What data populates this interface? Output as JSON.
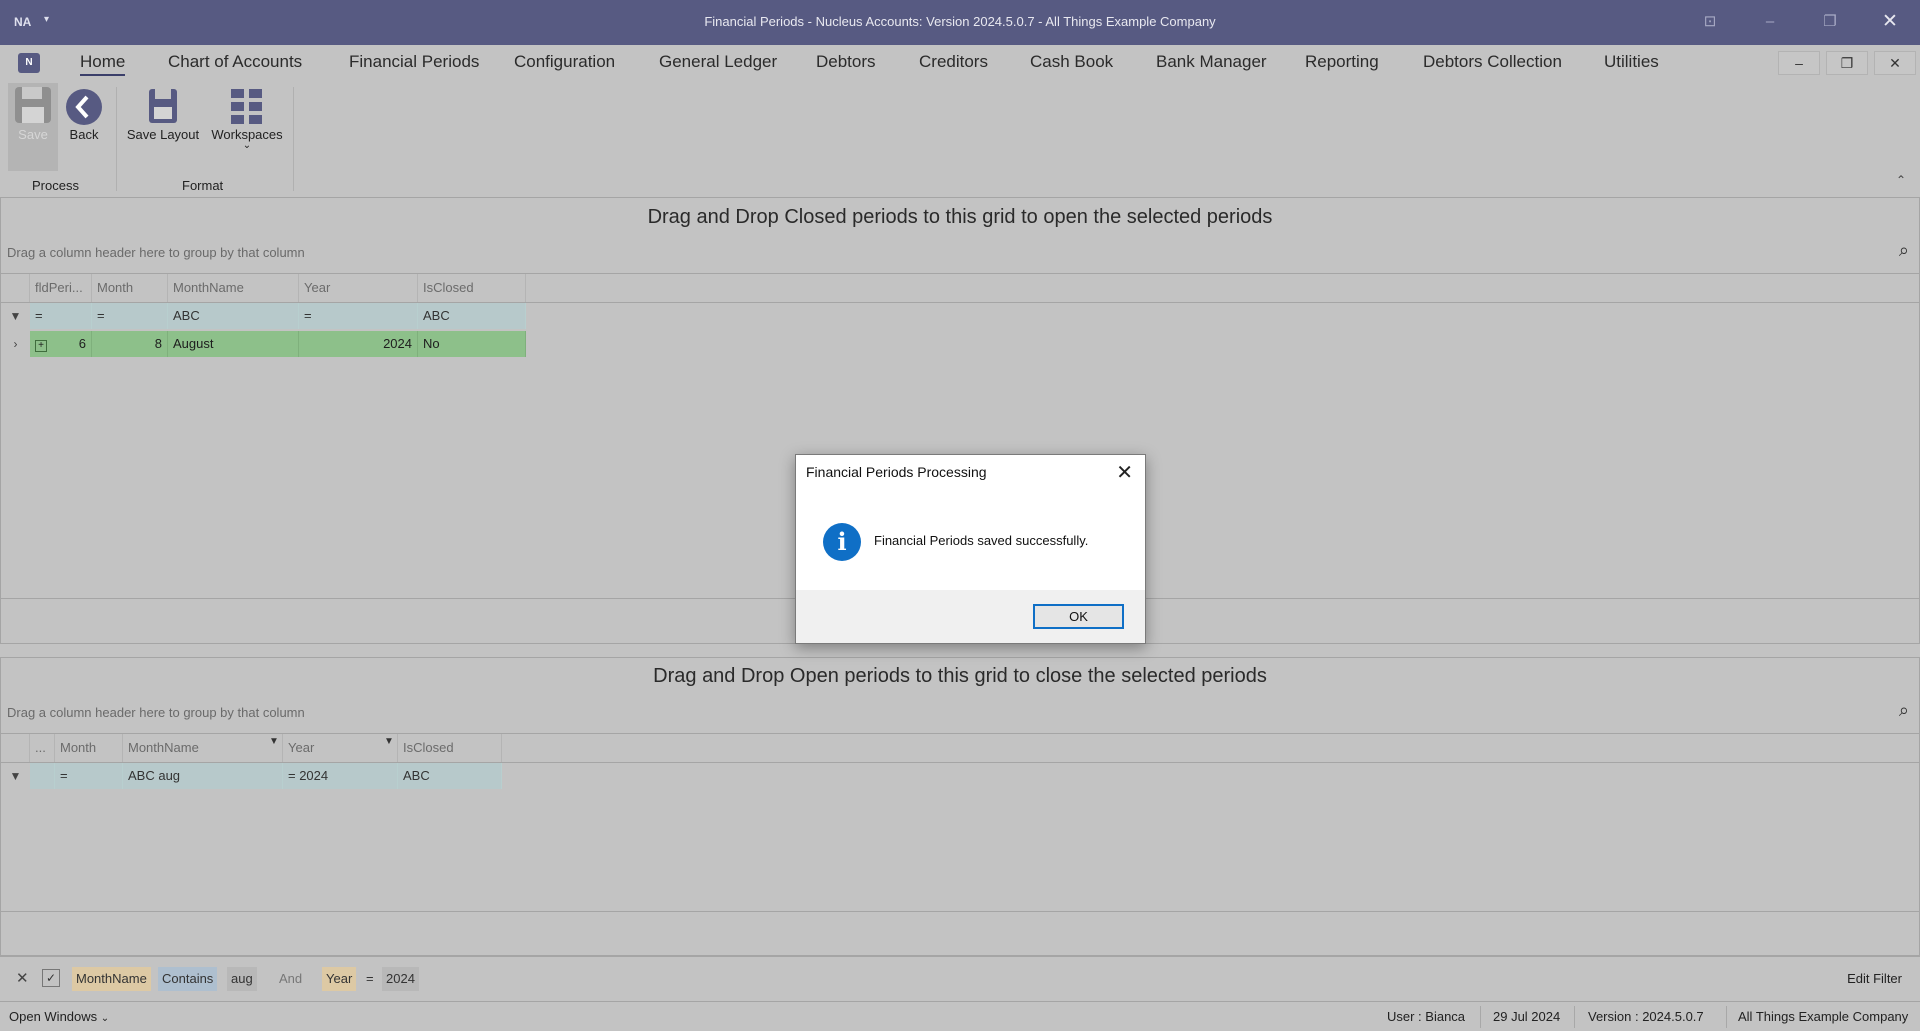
{
  "window": {
    "title": "Financial Periods - Nucleus Accounts: Version 2024.5.0.7 - All Things Example Company",
    "app_icon": "app-logo-icon",
    "controls": {
      "minimize": "–",
      "restore": "❐",
      "close": "✕"
    }
  },
  "menu": {
    "items": [
      "Home",
      "Chart of Accounts",
      "Financial Periods",
      "Configuration",
      "General Ledger",
      "Debtors",
      "Creditors",
      "Cash Book",
      "Bank Manager",
      "Reporting",
      "Debtors Collection",
      "Utilities"
    ],
    "active": "Home",
    "mdi_controls": {
      "minimize": "–",
      "restore": "❐",
      "close": "✕"
    }
  },
  "ribbon": {
    "save_label": "Save",
    "back_label": "Back",
    "save_layout_label": "Save Layout",
    "workspaces_label": "Workspaces",
    "groups": {
      "process": "Process",
      "format": "Format"
    }
  },
  "top_grid": {
    "title": "Drag and Drop Closed periods to this grid to open the selected periods",
    "group_hint": "Drag a column header here to group by that column",
    "columns": [
      "fldPeri...",
      "Month",
      "MonthName",
      "Year",
      "IsClosed"
    ],
    "filter_row": [
      "=",
      "=",
      "ABC",
      "=",
      "ABC"
    ],
    "rows": [
      {
        "fldPeriod": "6",
        "Month": "8",
        "MonthName": "August",
        "Year": "2024",
        "IsClosed": "No"
      }
    ]
  },
  "bottom_grid": {
    "title": "Drag and Drop Open periods to this grid to close the selected periods",
    "group_hint": "Drag a column header here to group by that column",
    "columns": [
      "...",
      "Month",
      "MonthName",
      "Year",
      "IsClosed"
    ],
    "filter_row": [
      "",
      "=",
      "ABC aug",
      "= 2024",
      "ABC"
    ]
  },
  "dialog": {
    "title": "Financial Periods Processing",
    "message": "Financial Periods saved successfully.",
    "ok_label": "OK"
  },
  "filter_bar": {
    "field1": "MonthName",
    "op1": "Contains",
    "val1": "aug",
    "conj": "And",
    "field2": "Year",
    "op2": "=",
    "val2": "2024",
    "edit_filter": "Edit Filter"
  },
  "status_bar": {
    "open_windows": "Open Windows",
    "user": "User : Bianca",
    "date": "29 Jul 2024",
    "version": "Version : 2024.5.0.7",
    "company": "All Things Example Company"
  },
  "colors": {
    "titlebar": "#575a82",
    "accent": "#0f6fc6",
    "row_selected": "#8dc08a",
    "filter_row": "#b7c9cb"
  }
}
